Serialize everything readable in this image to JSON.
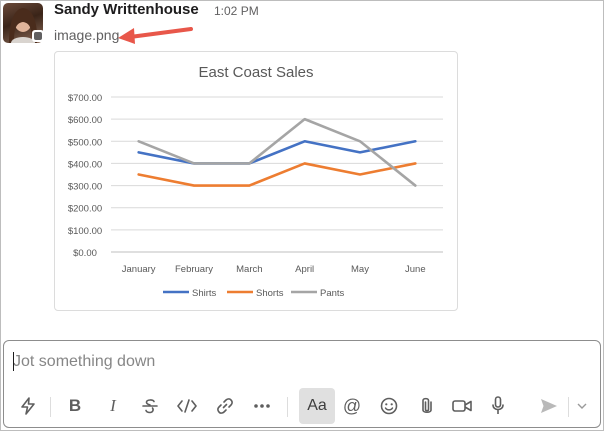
{
  "message": {
    "sender": "Sandy Writtenhouse",
    "time": "1:02 PM",
    "filename": "image.png"
  },
  "colors": {
    "annotation_arrow": "#e8574a",
    "shirts": "#4472c4",
    "shorts": "#ed7d31",
    "pants": "#a5a5a5"
  },
  "chart_data": {
    "type": "line",
    "title": "East Coast Sales",
    "categories": [
      "January",
      "February",
      "March",
      "April",
      "May",
      "June"
    ],
    "yticks": [
      "$0.00",
      "$100.00",
      "$200.00",
      "$300.00",
      "$400.00",
      "$500.00",
      "$600.00",
      "$700.00"
    ],
    "ylim": [
      0,
      700
    ],
    "grid": true,
    "legend": "bottom",
    "series": [
      {
        "name": "Shirts",
        "values": [
          450,
          400,
          400,
          500,
          450,
          500
        ],
        "color": "#4472c4"
      },
      {
        "name": "Shorts",
        "values": [
          350,
          300,
          300,
          400,
          350,
          400
        ],
        "color": "#ed7d31"
      },
      {
        "name": "Pants",
        "values": [
          500,
          400,
          400,
          600,
          500,
          300
        ],
        "color": "#a5a5a5"
      }
    ]
  },
  "composer": {
    "placeholder": "Jot something down",
    "value": ""
  },
  "toolbar": {
    "shortcuts": "shortcuts-icon",
    "bold": "B",
    "italic": "I",
    "strikethrough": "strikethrough-icon",
    "code": "code-icon",
    "link": "link-icon",
    "more": "more-icon",
    "formatting": "Aa",
    "mention": "@",
    "emoji": "emoji-icon",
    "attach": "paperclip-icon",
    "video": "video-icon",
    "audio": "microphone-icon",
    "send": "send-icon",
    "send_options": "chevron-down-icon"
  }
}
